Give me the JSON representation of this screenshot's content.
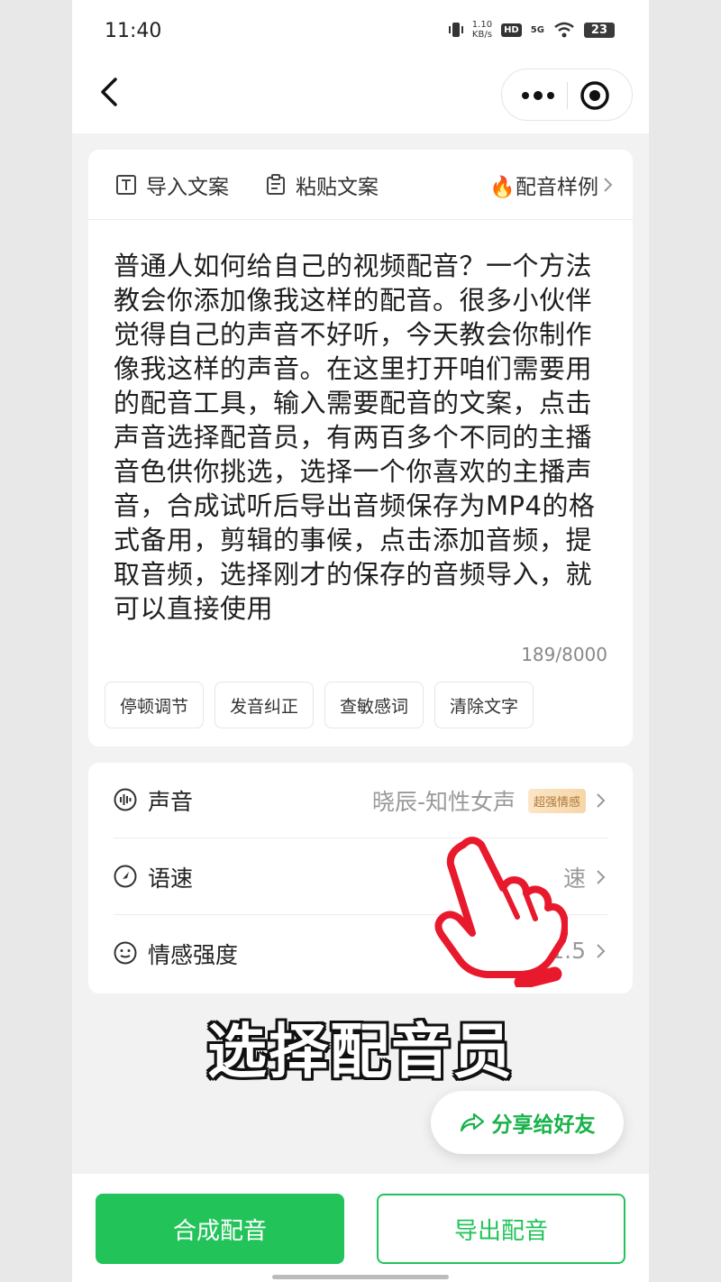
{
  "status_bar": {
    "time": "11:40",
    "net_speed_value": "1.10",
    "net_speed_unit": "KB/s",
    "hd": "HD",
    "signal": "5G",
    "battery": "23"
  },
  "nav": {
    "back_icon": "chevron-left-icon",
    "more_icon": "more-dots-icon",
    "close_icon": "target-close-icon"
  },
  "editor": {
    "toolbar": {
      "import_label": "导入文案",
      "paste_label": "粘贴文案",
      "samples_label": "🔥配音样例"
    },
    "text": "普通人如何给自己的视频配音？一个方法教会你添加像我这样的配音。很多小伙伴觉得自己的声音不好听，今天教会你制作像我这样的声音。在这里打开咱们需要用的配音工具，输入需要配音的文案，点击声音选择配音员，有两百多个不同的主播音色供你挑选，选择一个你喜欢的主播声音，合成试听后导出音频保存为MP4的格式备用，剪辑的事候，点击添加音频，提取音频，选择刚才的保存的音频导入，就可以直接使用",
    "char_count": "189/8000",
    "chips": [
      "停顿调节",
      "发音纠正",
      "查敏感词",
      "清除文字"
    ]
  },
  "settings": {
    "voice": {
      "label": "声音",
      "value": "晓辰-知性女声",
      "badge": "超强情感"
    },
    "speed": {
      "label": "语速",
      "value": "速"
    },
    "emotion": {
      "label": "情感强度",
      "value": "1.5"
    }
  },
  "subtitle": "选择配音员",
  "share_label": "分享给好友",
  "buttons": {
    "synthesize": "合成配音",
    "export": "导出配音"
  },
  "colors": {
    "accent_green": "#22c45a",
    "hand_red": "#e8192c"
  }
}
